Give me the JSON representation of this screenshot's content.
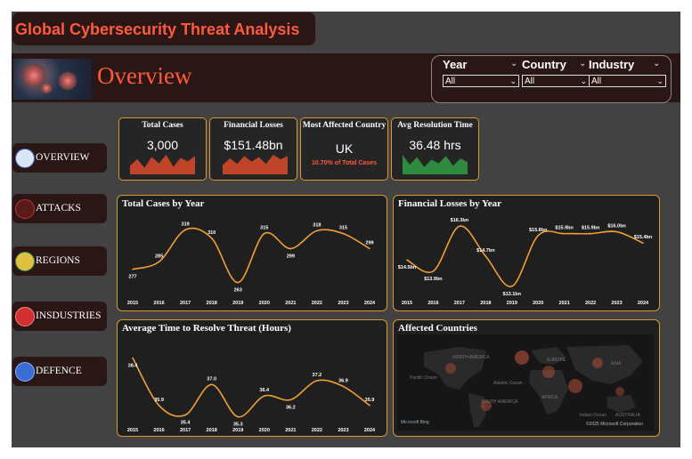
{
  "header": {
    "title": "Global Cybersecurity Threat Analysis",
    "page_title": "Overview"
  },
  "filters": [
    {
      "label": "Year",
      "value": "All"
    },
    {
      "label": "Country",
      "value": "All"
    },
    {
      "label": "Industry",
      "value": "All"
    }
  ],
  "nav": [
    {
      "label": "OVERVIEW",
      "icon": "overview-icon",
      "color": "#3a6ed6"
    },
    {
      "label": "ATTACKS",
      "icon": "attacks-icon",
      "color": "#c03030"
    },
    {
      "label": "REGIONS",
      "icon": "regions-icon",
      "color": "#2e9a4a"
    },
    {
      "label": "INSDUSTRIES",
      "icon": "industries-icon",
      "color": "#d03030"
    },
    {
      "label": "DEFENCE",
      "icon": "defence-icon",
      "color": "#3a6ed6"
    }
  ],
  "kpis": {
    "total_cases": {
      "title": "Total Cases",
      "value": "3,000"
    },
    "financial_losses": {
      "title": "Financial Losses",
      "value": "$151.48bn"
    },
    "most_affected": {
      "title": "Most Affected Country",
      "value": "UK",
      "sub": "10.70% of Total Cases"
    },
    "avg_resolution": {
      "title": "Avg Resolution Time",
      "value": "36.48 hrs"
    }
  },
  "colors": {
    "accent": "#ff5a3a",
    "line": "#f0a030",
    "spark_red": "#c0442a",
    "spark_green": "#2e8a3e",
    "border": "#d99a2a"
  },
  "chart_data": [
    {
      "type": "line",
      "title": "Total Cases by Year",
      "x": [
        "2015",
        "2016",
        "2017",
        "2018",
        "2019",
        "2020",
        "2021",
        "2022",
        "2023",
        "2024"
      ],
      "values": [
        277,
        285,
        319,
        310,
        263,
        315,
        299,
        318,
        315,
        299
      ],
      "labels": [
        "277",
        "285",
        "319",
        "310",
        "263",
        "315",
        "299",
        "318",
        "315",
        "299"
      ],
      "ylim": [
        255,
        325
      ]
    },
    {
      "type": "line",
      "title": "Financial Losses by Year",
      "x": [
        "2015",
        "2016",
        "2017",
        "2018",
        "2019",
        "2020",
        "2021",
        "2022",
        "2023",
        "2024"
      ],
      "values": [
        14.5,
        13.9,
        16.3,
        14.7,
        13.1,
        15.8,
        15.9,
        15.9,
        16.0,
        15.4
      ],
      "labels": [
        "$14.5bn",
        "$13.9bn",
        "$16.3bn",
        "$14.7bn",
        "$13.1bn",
        "$15.8bn",
        "$15.9bn",
        "$15.9bn",
        "$16.0bn",
        "$15.4bn"
      ],
      "ylim": [
        12.9,
        16.5
      ]
    },
    {
      "type": "line",
      "title": "Average Time to Resolve Threat (Hours)",
      "x": [
        "2015",
        "2016",
        "2017",
        "2018",
        "2019",
        "2020",
        "2021",
        "2022",
        "2023",
        "2024"
      ],
      "values": [
        38.4,
        35.9,
        35.4,
        37.0,
        35.3,
        36.4,
        36.2,
        37.2,
        36.9,
        35.9
      ],
      "labels": [
        "38.4",
        "35.9",
        "35.4",
        "37.0",
        "35.3",
        "36.4",
        "36.2",
        "37.2",
        "36.9",
        "35.9"
      ],
      "ylim": [
        35.0,
        38.7
      ]
    }
  ],
  "map": {
    "title": "Affected Countries",
    "labels": [
      "NORTH AMERICA",
      "EUROPE",
      "ASIA",
      "Atlantic Ocean",
      "Pacific Ocean",
      "SOUTH AMERICA",
      "AFRICA",
      "Indian Ocean",
      "AUSTRALIA"
    ],
    "credit": "Microsoft Bing",
    "copyright": "©2025 Microsoft Corporation"
  },
  "sparks": {
    "total_cases": [
      8,
      14,
      6,
      16,
      10,
      18,
      7,
      15,
      12,
      17
    ],
    "financial_losses": [
      8,
      14,
      9,
      16,
      11,
      15,
      9,
      17,
      13,
      16
    ],
    "avg_resolution": [
      16,
      8,
      14,
      6,
      12,
      9,
      15,
      7,
      13,
      10
    ]
  }
}
